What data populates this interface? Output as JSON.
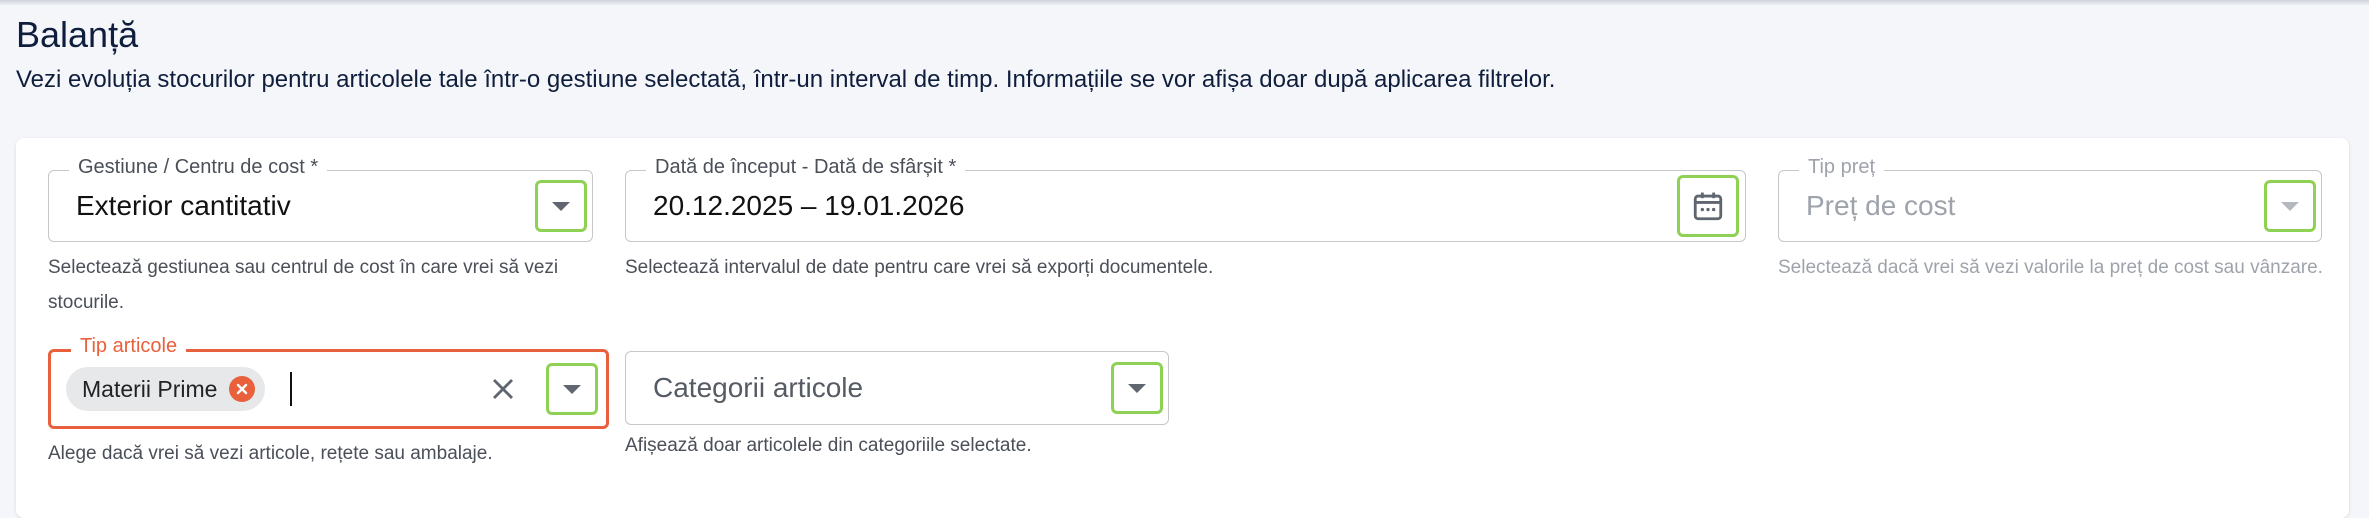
{
  "header": {
    "title": "Balanță",
    "subtitle": "Vezi evoluția stocurilor pentru articolele tale într-o gestiune selectată, într-un interval de timp. Informațiile se vor afișa doar după aplicarea filtrelor."
  },
  "filters": {
    "gestiune": {
      "label": "Gestiune / Centru de cost *",
      "value": "Exterior cantitativ",
      "helper": "Selectează gestiunea sau centrul de cost în care vrei să vezi stocurile.",
      "icon": "chevron-down-icon"
    },
    "date_range": {
      "label": "Dată de început - Dată de sfârșit *",
      "value": "20.12.2025 – 19.01.2026",
      "helper": "Selectează intervalul de date pentru care vrei să exporți documentele.",
      "icon": "calendar-icon"
    },
    "tip_pret": {
      "label": "Tip preț",
      "value": "Preț de cost",
      "helper": "Selectează dacă vrei să vezi valorile la preț de cost sau vânzare.",
      "icon": "chevron-down-icon"
    },
    "tip_articole": {
      "label": "Tip articole",
      "chips": [
        "Materii Prime"
      ],
      "helper": "Alege dacă vrei să vezi articole, rețete sau ambalaje.",
      "icon": "chevron-down-icon"
    },
    "categorii": {
      "placeholder": "Categorii articole",
      "helper": "Afișează doar articolele din categoriile selectate.",
      "icon": "chevron-down-icon"
    }
  },
  "colors": {
    "accent_error": "#e8603c",
    "highlight": "#8fd154",
    "text_primary": "#0f1e3d"
  }
}
